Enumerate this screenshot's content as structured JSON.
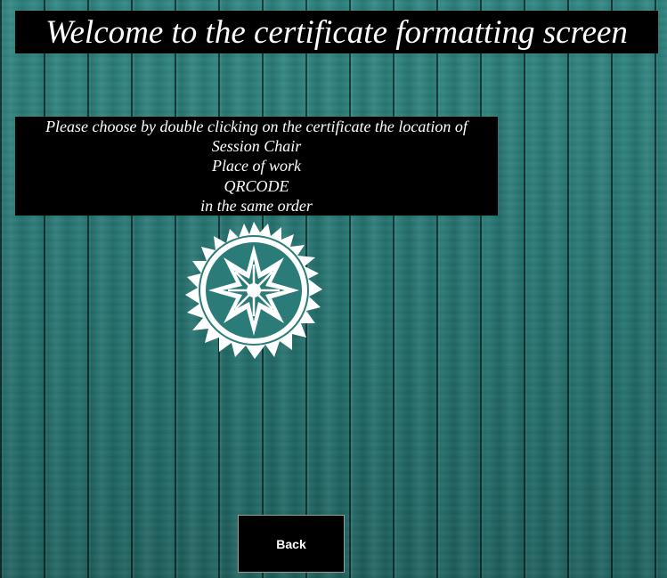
{
  "header": {
    "title": "Welcome to the certificate formatting screen"
  },
  "instructions": {
    "lines": [
      "Please choose by double clicking on the certificate the location of",
      "Session Chair",
      "Place of work",
      "QRCODE",
      "in the same order"
    ]
  },
  "logo": {
    "icon": "snowflake-emblem-icon",
    "color": "#ffffff"
  },
  "footer": {
    "back_label": "Back"
  },
  "colors": {
    "background": "#2b7c78",
    "panel": "#000000",
    "text": "#ffffff"
  }
}
